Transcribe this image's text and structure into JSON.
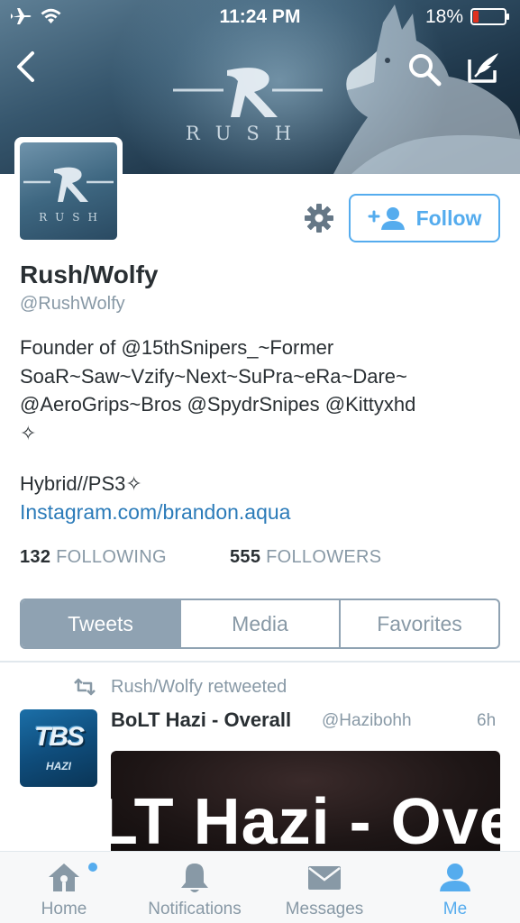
{
  "status_bar": {
    "time": "11:24 PM",
    "battery_percent": "18%",
    "battery_level": 0.18,
    "icons": [
      "airplane-icon",
      "wifi-icon",
      "battery-icon"
    ]
  },
  "header": {
    "banner_brand_text": "RUSH",
    "nav_icons": [
      "back-icon",
      "search-icon",
      "compose-icon"
    ]
  },
  "profile": {
    "avatar_text": "RUSH",
    "display_name": "Rush/Wolfy",
    "handle": "@RushWolfy",
    "bio": "Founder of @15thSnipers_~Former\nSoaR~Saw~Vzify~Next~SuPra~eRa~Dare~\n@AeroGrips~Bros @SpydrSnipes @Kittyxhd\n✧",
    "location": "Hybrid//PS3✧",
    "website": "Instagram.com/brandon.aqua",
    "following_count": "132",
    "following_label": "FOLLOWING",
    "followers_count": "555",
    "followers_label": "FOLLOWERS"
  },
  "actions": {
    "follow_label": "Follow",
    "settings_icon": "gear-icon",
    "follow_icon": "add-user-icon"
  },
  "tabs": [
    {
      "label": "Tweets",
      "active": true
    },
    {
      "label": "Media",
      "active": false
    },
    {
      "label": "Favorites",
      "active": false
    }
  ],
  "tweet": {
    "retweet_text": "Rush/Wolfy retweeted",
    "avatar_text": "TBS",
    "avatar_subtext": "HAZI",
    "name": "BoLT Hazi - Overall",
    "handle": "@Hazibohh",
    "time": "6h",
    "media_text": "LT Hazi - Ove"
  },
  "tab_bar": [
    {
      "label": "Home",
      "icon": "home-icon",
      "active": false,
      "badge": true
    },
    {
      "label": "Notifications",
      "icon": "bell-icon",
      "active": false
    },
    {
      "label": "Messages",
      "icon": "envelope-icon",
      "active": false
    },
    {
      "label": "Me",
      "icon": "person-icon",
      "active": true
    }
  ],
  "colors": {
    "accent": "#55acee",
    "link": "#2b7bb9",
    "muted": "#8899a6",
    "text": "#292f33",
    "tab_active_bg": "#8fa2b2",
    "battery_low": "#e0311f"
  }
}
